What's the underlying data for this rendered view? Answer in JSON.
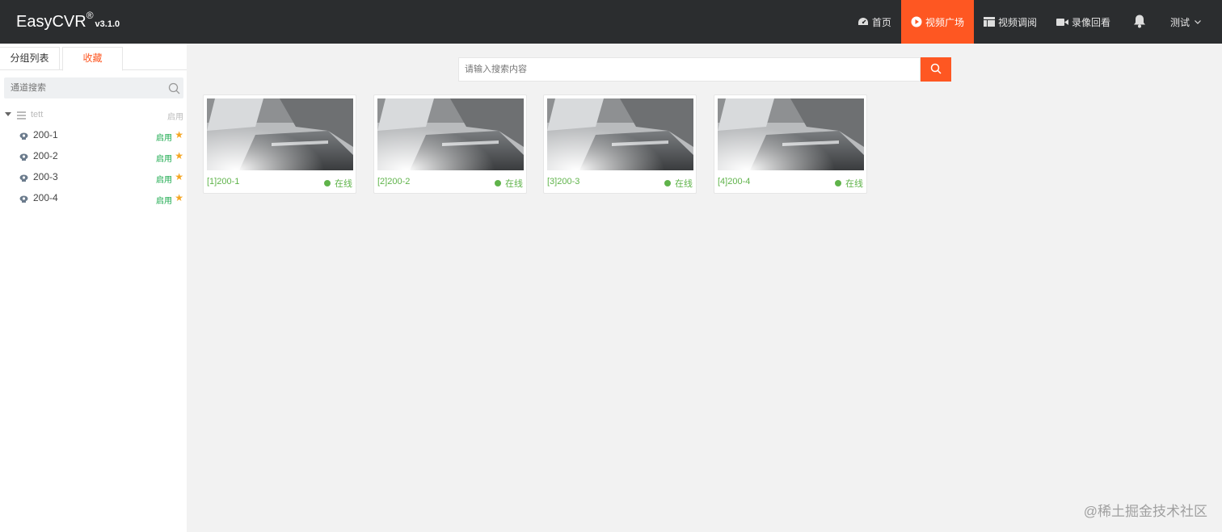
{
  "header": {
    "brand": "EasyCVR",
    "brand_reg": "®",
    "version": "v3.1.0",
    "nav": [
      {
        "label": "首页",
        "icon": "dashboard-icon"
      },
      {
        "label": "视频广场",
        "icon": "play-circle-icon",
        "active": true
      },
      {
        "label": "视频调阅",
        "icon": "layout-icon"
      },
      {
        "label": "录像回看",
        "icon": "video-camera-icon"
      }
    ],
    "bell_icon": "bell-icon",
    "user": "测试"
  },
  "sidebar": {
    "tabs": [
      "分组列表",
      "收藏"
    ],
    "active_tab": "收藏",
    "search_placeholder": "通道搜索",
    "root": {
      "label": "tett",
      "status": "启用"
    },
    "items": [
      {
        "label": "200-1",
        "status": "启用"
      },
      {
        "label": "200-2",
        "status": "启用"
      },
      {
        "label": "200-3",
        "status": "启用"
      },
      {
        "label": "200-4",
        "status": "启用"
      }
    ]
  },
  "main": {
    "search_placeholder": "请输入搜索内容",
    "cards": [
      {
        "name": "[1]200-1",
        "status": "在线"
      },
      {
        "name": "[2]200-2",
        "status": "在线"
      },
      {
        "name": "[3]200-3",
        "status": "在线"
      },
      {
        "name": "[4]200-4",
        "status": "在线"
      }
    ]
  },
  "watermark": "@稀土掘金技术社区",
  "colors": {
    "accent": "#fe5722",
    "header_bg": "#2b2d2f",
    "online": "#5fb34a",
    "enabled": "#1aa94c",
    "star": "#f5a623"
  }
}
